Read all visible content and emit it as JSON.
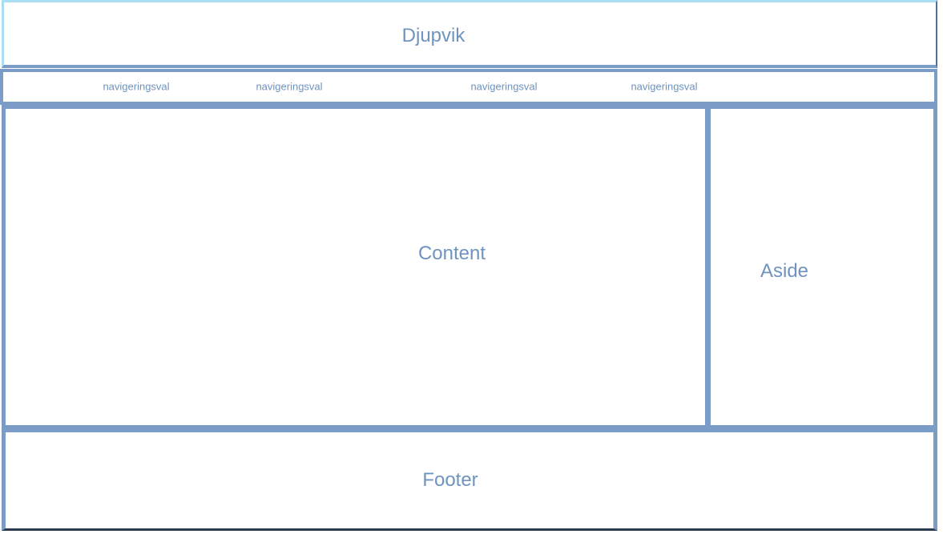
{
  "header": {
    "title": "Djupvik"
  },
  "nav": {
    "items": [
      {
        "label": "navigeringsval"
      },
      {
        "label": "navigeringsval"
      },
      {
        "label": "navigeringsval"
      },
      {
        "label": "navigeringsval"
      }
    ]
  },
  "content": {
    "label": "Content"
  },
  "aside": {
    "label": "Aside"
  },
  "footer": {
    "label": "Footer"
  },
  "colors": {
    "border": "#7b9cc7",
    "header_border_accent": "#a9dff0",
    "text": "#6f93bf",
    "background": "#ffffff"
  }
}
